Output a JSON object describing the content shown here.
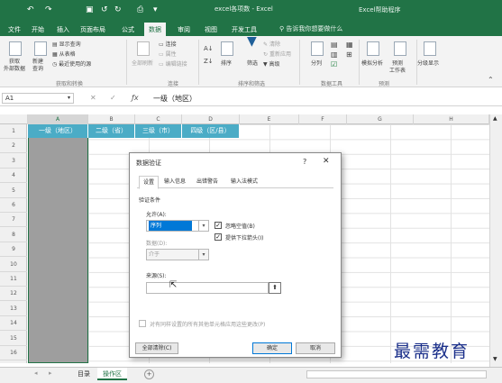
{
  "title_bar": {
    "doc_title": "excel各项数 - Excel",
    "account": "Excel帮助程序",
    "colors": {
      "brand": "#217346",
      "header_fill": "#4bacc6",
      "selection": "#0078d7"
    }
  },
  "tabs": [
    "文件",
    "开始",
    "插入",
    "页面布局",
    "公式",
    "数据",
    "审阅",
    "视图",
    "开发工具"
  ],
  "tell_me": "告诉我你想要做什么",
  "ribbon": {
    "get_data_items": [
      "显示查询",
      "从表格",
      "最近使用的源"
    ],
    "external_data": "获取\n外部数据",
    "new_query": "新建\n查询",
    "refresh_all": "全部刷新",
    "connection_items": [
      "连接",
      "属性",
      "编辑链接"
    ],
    "sort_asc": "升序",
    "sort_desc": "降序",
    "sort": "排序",
    "filter": "筛选",
    "filter_items": [
      "清除",
      "重新应用",
      "高级"
    ],
    "text_to_columns": "分列",
    "what_if": "模拟分析",
    "forecast": "预测\n工作表",
    "outline": "分级显示",
    "groups": [
      "获取和转换",
      "连接",
      "排序和筛选",
      "数据工具",
      "预测"
    ]
  },
  "formula_bar": {
    "cell_ref": "A1",
    "content": "一级（地区）"
  },
  "columns": [
    "A",
    "B",
    "C",
    "D",
    "E",
    "F",
    "G",
    "H"
  ],
  "rows": [
    "1",
    "2",
    "3",
    "4",
    "5",
    "6",
    "7",
    "8",
    "9",
    "10",
    "11",
    "12",
    "13",
    "14",
    "15",
    "16"
  ],
  "header_cells": [
    "一级（地区）",
    "二级（省）",
    "三级（市）",
    "四级（区/县）"
  ],
  "sheets": [
    "目录",
    "操作区"
  ],
  "active_sheet": "操作区",
  "dialog": {
    "title": "数据验证",
    "help": "?",
    "close": "✕",
    "tabs": [
      "设置",
      "输入信息",
      "出错警告",
      "输入法模式"
    ],
    "active_tab": "设置",
    "section_title": "验证条件",
    "allow_label": "允许(A):",
    "allow_value": "序列",
    "ignore_blank": "忽略空值(B)",
    "dropdown_arrow": "提供下拉箭头(I)",
    "data_label": "数据(D):",
    "data_value": "介于",
    "source_label": "来源(S):",
    "source_value": "",
    "apply_all": "对有同样设置的所有其他单元格应用这些更改(P)",
    "clear_all": "全部清除(C)",
    "ok": "确定",
    "cancel": "取消"
  },
  "watermark": "最需教育"
}
